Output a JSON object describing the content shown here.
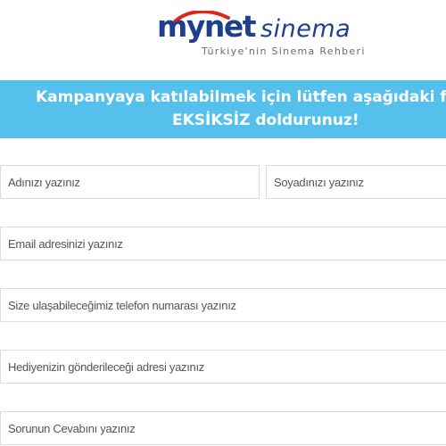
{
  "logo": {
    "brand": "mynet",
    "product": "sinema",
    "tagline": "Türkiye'nin Sinema Rehberi"
  },
  "banner": {
    "line1": "Kampanyaya katılabilmek için lütfen aşağıdaki f",
    "line2": "EKSİKSİZ doldurunuz!"
  },
  "form": {
    "name_placeholder": "Adınızı yazınız",
    "surname_placeholder": "Soyadınızı yazınız",
    "email_placeholder": "Email adresinizi yazınız",
    "phone_placeholder": "Size ulaşabileceğimiz telefon numarası yazınız",
    "address_placeholder": "Hediyenizin gönderileceği adresi yazınız",
    "answer_placeholder": "Sorunun Cevabını yazınız"
  },
  "colors": {
    "banner_bg": "#55c0ec",
    "logo_blue": "#1e3f8c",
    "logo_red": "#e2231a"
  }
}
